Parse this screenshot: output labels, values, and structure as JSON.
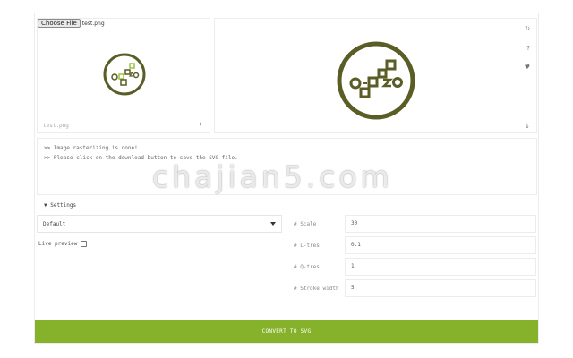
{
  "file_input": {
    "button_label": "Choose File",
    "file_name": "test.png"
  },
  "preview": {
    "image_label": "test.png",
    "next_icon": "chevron-right-icon"
  },
  "output_toolbar": {
    "icons": [
      "refresh-icon",
      "help-icon",
      "heart-icon",
      "download-icon"
    ],
    "refresh_glyph": "↻",
    "help_glyph": "?",
    "heart_glyph": "♥",
    "download_glyph": "↓"
  },
  "console": {
    "lines": [
      ">> Image rasterizing is done!",
      ">> Please click on the download button to save the SVG file."
    ]
  },
  "settings": {
    "toggle_label": "▼ Settings",
    "mode_value": "Default",
    "live_preview_label": "Live preview",
    "live_preview_checked": false,
    "params": [
      {
        "label": "# Scale",
        "value": "30"
      },
      {
        "label": "# L-tres",
        "value": "0.1"
      },
      {
        "label": "# Q-tres",
        "value": "1"
      },
      {
        "label": "# Stroke width",
        "value": "5"
      }
    ]
  },
  "convert_button_label": "CONVERT TO SVG",
  "watermark_text": "chajian5.com",
  "colors": {
    "accent": "#86b12a",
    "logo_dark": "#5a5d25",
    "logo_light": "#9bc23c"
  }
}
